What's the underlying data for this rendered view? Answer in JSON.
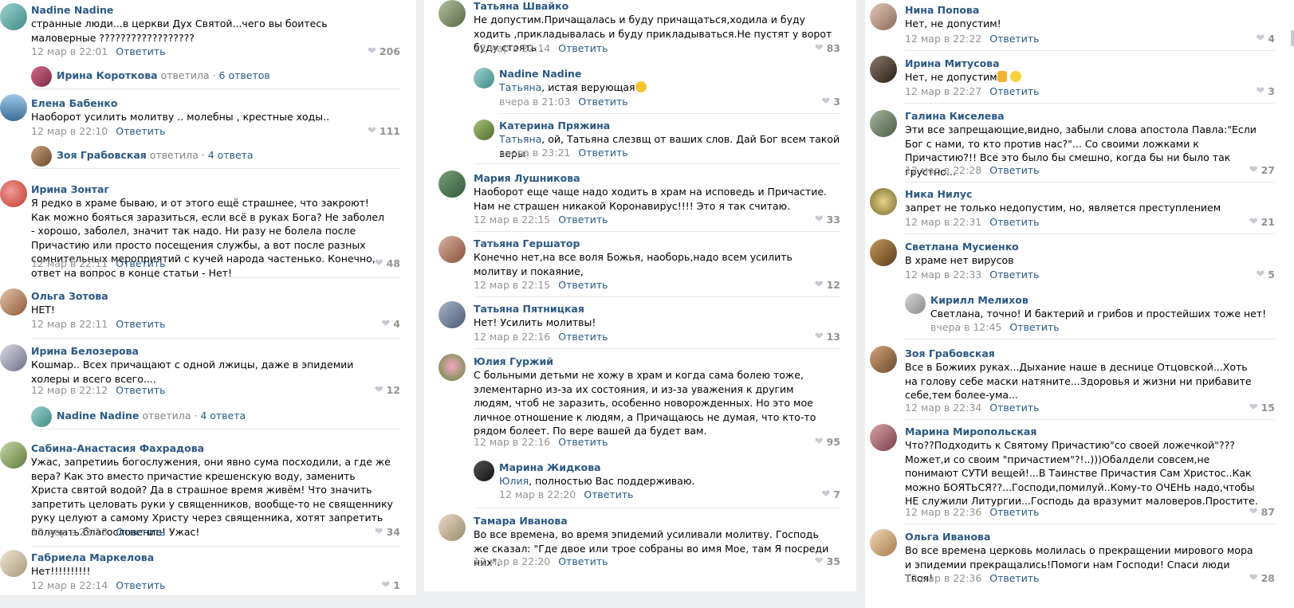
{
  "ui": {
    "reply_label": "Ответить",
    "replied_word": "ответила"
  },
  "col1": {
    "c1": {
      "author": "Nadine Nadine",
      "text": "странные люди...в церкви Дух Святой...чего вы боитесь маловерные ??????????????????",
      "time": "12 мар в 22:01",
      "likes": "206"
    },
    "t1": {
      "name": "Ирина Короткова",
      "count": "6 ответов"
    },
    "c2": {
      "author": "Елена Бабенко",
      "text": "Наоборот усилить молитву .. молебны , крестные ходы..",
      "time": "12 мар в 22:10",
      "likes": "111"
    },
    "t2": {
      "name": "Зоя Грабовская",
      "count": "4 ответа"
    },
    "c3": {
      "author": "Ирина Зонтаг",
      "text": "Я редко в храме бываю, и от этого ещё страшнее, что закроют! Как можно бояться заразиться, если всё в руках Бога? Не заболел - хорошо, заболел, значит так надо. Ни разу не болела после Причастию или просто посещения службы, а вот после разных сомнительных мероприятий с кучей народа частенько. Конечно, ответ на вопрос в конце статьи - Нет!",
      "time": "12 мар в 22:11",
      "likes": "48"
    },
    "c4": {
      "author": "Ольга Зотова",
      "text": "НЕТ!",
      "time": "12 мар в 22:11",
      "likes": "4"
    },
    "c5": {
      "author": "Ирина Белозерова",
      "text": "Кошмар.. Всех причащают с одной лжицы, даже в эпидемии холеры и всего всего....",
      "time": "12 мар в 22:12",
      "likes": "12"
    },
    "t3": {
      "name": "Nadine Nadine",
      "count": "4 ответа"
    },
    "c6": {
      "author": "Сабина-Анастасия Фахрадова",
      "text": "Ужас, запретииь богослужения, они явно сума посходили, а где же вера? Как это вместо причастие крешенскую воду, заменить Христа святой водой? Да в страшное время живём! Что значить запретить целовать руки у священников, вообще-то не священнику руку целуют а самому Христу через священника, хотят запретить получать благословение! Ужас!",
      "time": "12 мар в 22:13",
      "likes": "34"
    },
    "c7": {
      "author": "Габриела Маркелова",
      "text": "Нет!!!!!!!!!!",
      "time": "12 мар в 22:14",
      "likes": "1"
    }
  },
  "col2": {
    "c1": {
      "author": "Татьяна Швайко",
      "text": "Не допустим.Причащалась и буду причащаться,ходила и буду ходить ,прикладывалась и буду прикладываться.Не пустят у ворот буду стоять .",
      "time": "12 мар в 22:14",
      "likes": "83"
    },
    "r1": {
      "author": "Nadine Nadine",
      "addr": "Татьяна",
      "text": ", истая верующая",
      "time": "вчера в 21:03",
      "likes": "3"
    },
    "r2": {
      "author": "Катерина Пряжина",
      "addr": "Татьяна",
      "text": ", ой, Татьяна слезвщ от ваших слов. Дай Бог всем такой веры",
      "time": "вчера в 23:21"
    },
    "c2": {
      "author": "Мария Лушникова",
      "text": "Наоборот еще чаще надо ходить в храм на исповедь и Причастие. Нам не страшен никакой Коронавирус!!!! Это я так считаю.",
      "time": "12 мар в 22:15",
      "likes": "33"
    },
    "c3": {
      "author": "Татьяна Гершатор",
      "text": "Конечно нет,на все воля Божья, наоборь,надо всем усилить молитву и покаяние,",
      "time": "12 мар в 22:15",
      "likes": "12"
    },
    "c4": {
      "author": "Татьяна Пятницкая",
      "text": "Нет! Усилить молитвы!",
      "time": "12 мар в 22:16",
      "likes": "13"
    },
    "c5": {
      "author": "Юлия Гуржий",
      "text": "С больными детьми не хожу в храм и когда сама болею тоже, элементарно из-за их состояния, и из-за уважения к другим людям, чтоб не заразить, особенно новорожденных. Но это мое личное отношение к людям, а Причащаюсь не думая, что кто-то рядом болеет. По вере вашей да будет вам.",
      "time": "12 мар в 22:16",
      "likes": "95"
    },
    "r3": {
      "author": "Марина Жидкова",
      "addr": "Юлия",
      "text": ", полностью Вас поддерживаю.",
      "time": "12 мар в 22:20",
      "likes": "7"
    },
    "c6": {
      "author": "Тамара Иванова",
      "text": "Во все времена, во время эпидемий усиливали молитву. Господь же сказал: \"Где двое или трое собраны во имя Мое, там Я посреди них\".",
      "time": "12 мар в 22:20",
      "likes": "35"
    }
  },
  "col3": {
    "c1": {
      "author": "Нина Попова",
      "text": "Нет, не допустим!",
      "time": "12 мар в 22:22",
      "likes": "4"
    },
    "c2": {
      "author": "Ирина Митусова",
      "text": "Нет, не допустим",
      "time": "12 мар в 22:27",
      "likes": "3"
    },
    "c3": {
      "author": "Галина Киселева",
      "text": "Эти все запрещающие,видно, забыли слова апостола Павла:\"Если Бог с нами, то кто против нас?\"... Со своими ложками к Причастию?!! Все это было бы смешно, когда бы ни было так грустно...",
      "time": "12 мар в 22:28",
      "likes": "27"
    },
    "c4": {
      "author": "Ника Нилус",
      "text": "запрет не только недопустим, но, является преступлением",
      "time": "12 мар в 22:31",
      "likes": "21"
    },
    "c5": {
      "author": "Светлана Мусиенко",
      "text": "В храме нет вирусов",
      "time": "12 мар в 22:33",
      "likes": "5"
    },
    "r1": {
      "author": "Кирилл Мелихов",
      "text": "Светлана, точно! И бактерий и грибов и простейших тоже нет!",
      "time": "вчера в 12:45"
    },
    "c6": {
      "author": "Зоя Грабовская",
      "text": "Все в Божиих руках...Дыхание наше в деснице Отцовской...Хоть на голову себе маски натяните...Здоровья и жизни ни прибавите себе,тем более-ума...",
      "time": "12 мар в 22:34",
      "likes": "15"
    },
    "c7": {
      "author": "Марина Миропольская",
      "text": "Что??Подходить к Святому Причастию\"со своей ложечкой\"???Может,и со своим \"причастием\"?!..)))Обалдели совсем,не понимают СУТИ вещей!...В Таинстве Причастия Сам Христос..Как можно БОЯТЬСЯ??...Господи,помилуй..Кому-то ОЧЕНЬ надо,чтобы НЕ служили Литургии...Господь да вразумит маловеров.Простите.",
      "time": "12 мар в 22:36",
      "likes": "87"
    },
    "c8": {
      "author": "Ольга Иванова",
      "text": "Во все времена церковь молилась о прекращении мирового мора и эпидемии прекращались!Помоги нам Господи! Спаси люди Твоя!",
      "time": "12 мар в 22:36",
      "likes": "28"
    }
  },
  "icons": {
    "like": "heart-icon",
    "avatar": "user-avatar"
  },
  "colors": {
    "link": "#2a5885",
    "meta": "#939393",
    "background": "#edeef0"
  }
}
